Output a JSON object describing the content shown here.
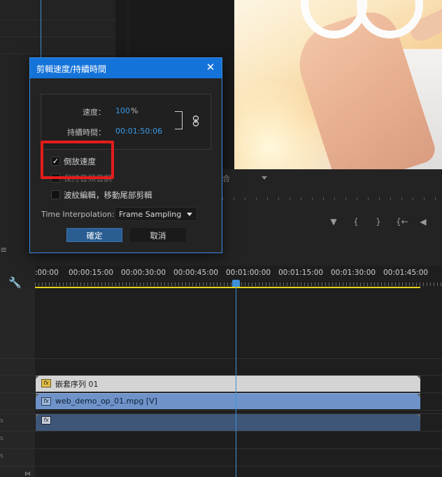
{
  "dialog": {
    "title": "剪輯速度/持續時間",
    "speed_label": "速度：",
    "speed_value": "100",
    "speed_unit": "%",
    "duration_label": "持續時間：",
    "duration_value": "00:01:50:06",
    "reverse_speed_label": "倒放速度",
    "reverse_speed_checked": true,
    "maintain_pitch_label": "保持音頻音調",
    "ripple_edit_label": "波紋編輯，移動尾部剪輯",
    "time_interpolation_label": "Time Interpolation:",
    "time_interpolation_value": "Frame Sampling",
    "ok_label": "確定",
    "cancel_label": "取消",
    "close_glyph": "✕"
  },
  "program": {
    "fit_select_value": "合"
  },
  "timeline": {
    "menu_glyph": "≡",
    "time_labels": [
      ":00:00",
      "00:00:15:00",
      "00:00:30:00",
      "00:00:45:00",
      "00:01:00:00",
      "00:01:15:00",
      "00:01:30:00",
      "00:01:45:00"
    ],
    "clips": {
      "nested_sequence": "嵌套序列 01",
      "video_clip": "web_demo_op_01.mpg [V]",
      "audio_clip": ""
    },
    "fx_badge": "fx"
  },
  "icons": {
    "close": "close-icon",
    "link": "link-icon",
    "wrench": "wrench-icon",
    "dropdown": "chevron-down-icon"
  },
  "colors": {
    "title_bar": "#1473d8",
    "accent_value": "#3a9be6",
    "highlight_box": "#e41c1c",
    "playhead": "#3d8fd6",
    "work_area": "#e8d416",
    "nested_clip": "#d4d4d4",
    "video_clip": "#6f93c9",
    "audio_clip": "#3e5678"
  }
}
